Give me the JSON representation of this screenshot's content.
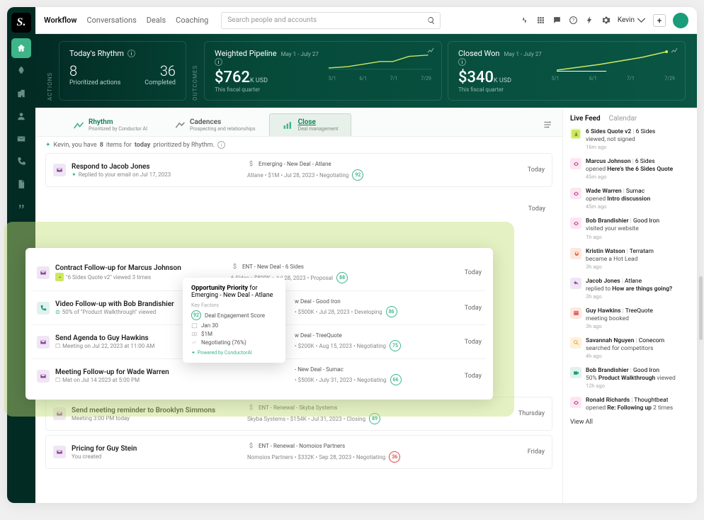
{
  "logo_letter": "S.",
  "topnav": {
    "workflow": "Workflow",
    "conversations": "Conversations",
    "deals": "Deals",
    "coaching": "Coaching"
  },
  "search": {
    "placeholder": "Search people and accounts"
  },
  "user_name": "Kevin",
  "hero": {
    "actions_label": "ACTIONS",
    "outcomes_label": "OUTCOMES",
    "rhythm": {
      "title": "Today's Rhythm",
      "prioritized_count": "8",
      "prioritized_label": "Prioritized actions",
      "completed_count": "36",
      "completed_label": "Completed"
    },
    "pipeline": {
      "title": "Weighted Pipeline",
      "date_range": "May 1 - July 27",
      "value": "$762",
      "unit": "K",
      "currency": "USD",
      "sub": "This fiscal quarter"
    },
    "closed": {
      "title": "Closed Won",
      "date_range": "May 1 - July 27",
      "value": "$340",
      "unit": "K",
      "currency": "USD",
      "sub": "This fiscal quarter"
    },
    "axis": [
      "5/1",
      "6/1",
      "7/1",
      "7/29"
    ],
    "axis2": [
      "5/1",
      "6/1",
      "7/1",
      "7/29"
    ]
  },
  "tabs": {
    "rhythm": {
      "label": "Rhythm",
      "sub": "Prioritized by Conductor AI"
    },
    "cadences": {
      "label": "Cadences",
      "sub": "Prospecting and relationships"
    },
    "close": {
      "label": "Close",
      "sub": "Deal management"
    }
  },
  "message": {
    "pre": "Kevin, you have",
    "count": "8",
    "mid": "items for",
    "today": "today",
    "post": "prioritized by Rhythm."
  },
  "days": {
    "today": "Today",
    "thursday": "Thursday",
    "friday": "Friday"
  },
  "tasks": {
    "t1": {
      "title": "Respond to Jacob Jones",
      "sub": "Replied to your email on Jul 17, 2023",
      "mid1": "Emerging - New Deal - Atlane",
      "mid2": "Atlane   •   $1M   •   Jul 28, 2023   •   Negotiating",
      "score": "92"
    },
    "t6": {
      "title": "Send meeting reminder to Brooklyn Simmons",
      "sub": "Meeting 3:00 PM today",
      "mid1": "ENT - Renewal - Skyba Systems",
      "mid2": "Skyba Systems   •   $154K   •   Jul 31, 2023   •   Closing",
      "score": "89"
    },
    "t7": {
      "title": "Pricing for Guy Stein",
      "sub": "You created",
      "mid1": "ENT - Renewal - Nomoios Partners",
      "mid2": "Nomoios Partners   •   $332K   •   Sep 28, 2023   •   Negotiating",
      "score": "36"
    }
  },
  "popup": {
    "p1": {
      "title": "Contract Follow-up for Marcus Johnson",
      "sub": "\"6 Sides Quote v2\" viewed 3 times",
      "mid1": "ENT - New Deal - 6 Sides",
      "mid2": "6 Sides   •   $800K   •   Jul 28, 2023   •   Proposal",
      "score": "88"
    },
    "p2": {
      "title": "Video Follow-up with Bob Brandishier",
      "sub": "50% of \"Product Walkthrough\" viewed",
      "mid1": "w Deal - Good Iron",
      "mid2": "•   $500K   •   Jul 28, 2023   •   Developing",
      "score": "86"
    },
    "p3": {
      "title": "Send Agenda to Guy Hawkins",
      "sub": "Meeting on Jul 22, 2023 at 11:00 AM",
      "mid1": "w Deal - TreeQuote",
      "mid2": "•   $200K   •   Aug 15, 2023   •   Negotiating",
      "score": "75"
    },
    "p4": {
      "title": "Meeting Follow-up for Wade Warren",
      "sub": "Met on Jul 14 2023 at 5:00 PM",
      "mid1": "- New Deal - Sumac",
      "mid2": "•   $500K   •   July 31, 2023   •   Negotiating",
      "score": "66"
    }
  },
  "tooltip": {
    "title_pre": "Opportunity Priority",
    "title_for": "for",
    "title_deal": "Emerging - New Deal - Atlane",
    "kf": "Key Factors",
    "r1_score": "92",
    "r1": "Deal Engagement Score",
    "r2": "Jan 30",
    "r3": "$1M",
    "r4": "Negotiating (76%)",
    "footer": "Powered by ConductorAI"
  },
  "rp": {
    "live_feed": "Live Feed",
    "calendar": "Calendar",
    "view_all": "View All"
  },
  "feed": [
    {
      "ico": "dl",
      "name": "6 Sides Quote v2",
      "acct": "6 Sides",
      "act": "viewed, not signed",
      "time": "16m ago"
    },
    {
      "ico": "eye",
      "name": "Marcus Johnson",
      "acct": "6 Sides",
      "act_pre": "opened",
      "act_b": "Here's the 6 Sides Quote",
      "time": "45m ago"
    },
    {
      "ico": "eye",
      "name": "Wade Warren",
      "acct": "Sumac",
      "act_pre": "opened",
      "act_b": "Intro discussion",
      "time": "45m ago"
    },
    {
      "ico": "eye",
      "name": "Bob Brandishier",
      "acct": "Good Iron",
      "act": "visited your website",
      "time": "1h ago"
    },
    {
      "ico": "fire",
      "name": "Kristin Watson",
      "acct": "Terratam",
      "act": "became a Hot Lead",
      "time": "3h ago"
    },
    {
      "ico": "reply",
      "name": "Jacob Jones",
      "acct": "Atlane",
      "act_pre": "replied to",
      "act_b": "How are things going?",
      "time": "3h ago"
    },
    {
      "ico": "cal",
      "name": "Guy Hawkins",
      "acct": "TreeQuote",
      "act": "meeting booked",
      "time": "3h ago"
    },
    {
      "ico": "search",
      "name": "Savannah Nguyen",
      "acct": "Conecom",
      "act": "searched for competitors",
      "time": "4h ago"
    },
    {
      "ico": "vid",
      "name": "Bob Brandishier",
      "acct": "Good Iron",
      "act_pre": "50%",
      "act_b": "Product Walkthrough",
      "act_post": "viewed",
      "time": "12h ago"
    },
    {
      "ico": "eye",
      "name": "Ronald Richards",
      "acct": "Thoughtbeat",
      "act_pre": "opened",
      "act_b": "Re: Following up",
      "act_post": "2 times",
      "time": ""
    }
  ]
}
